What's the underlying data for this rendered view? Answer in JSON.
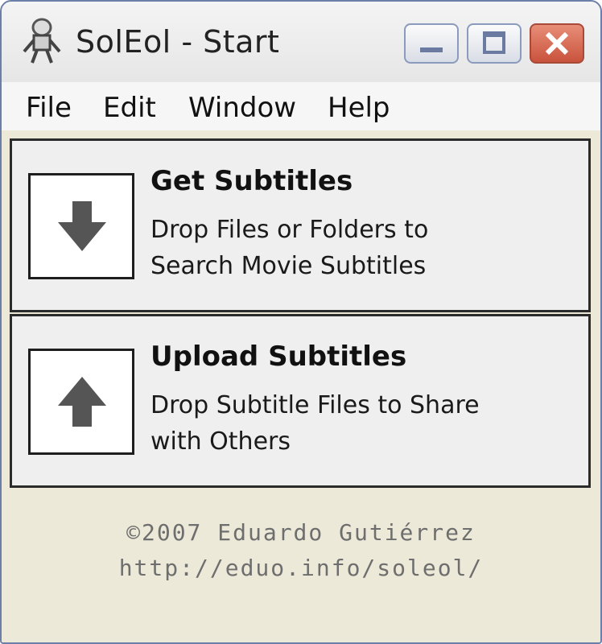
{
  "window": {
    "title": "SolEol - Start"
  },
  "menu": [
    "File",
    "Edit",
    "Window",
    "Help"
  ],
  "panels": {
    "get": {
      "title": "Get Subtitles",
      "line1": "Drop Files or Folders to",
      "line2": "Search Movie Subtitles",
      "icon": "arrow-down-icon"
    },
    "upload": {
      "title": "Upload Subtitles",
      "line1": "Drop Subtitle Files to Share",
      "line2": "with Others",
      "icon": "arrow-up-icon"
    }
  },
  "footer": {
    "copyright": "©2007 Eduardo Gutiérrez",
    "url": "http://eduo.info/soleol/"
  },
  "colors": {
    "close_button": "#c9533c",
    "panel_border": "#2b2b2b",
    "footer_text": "#6e6e6e"
  }
}
